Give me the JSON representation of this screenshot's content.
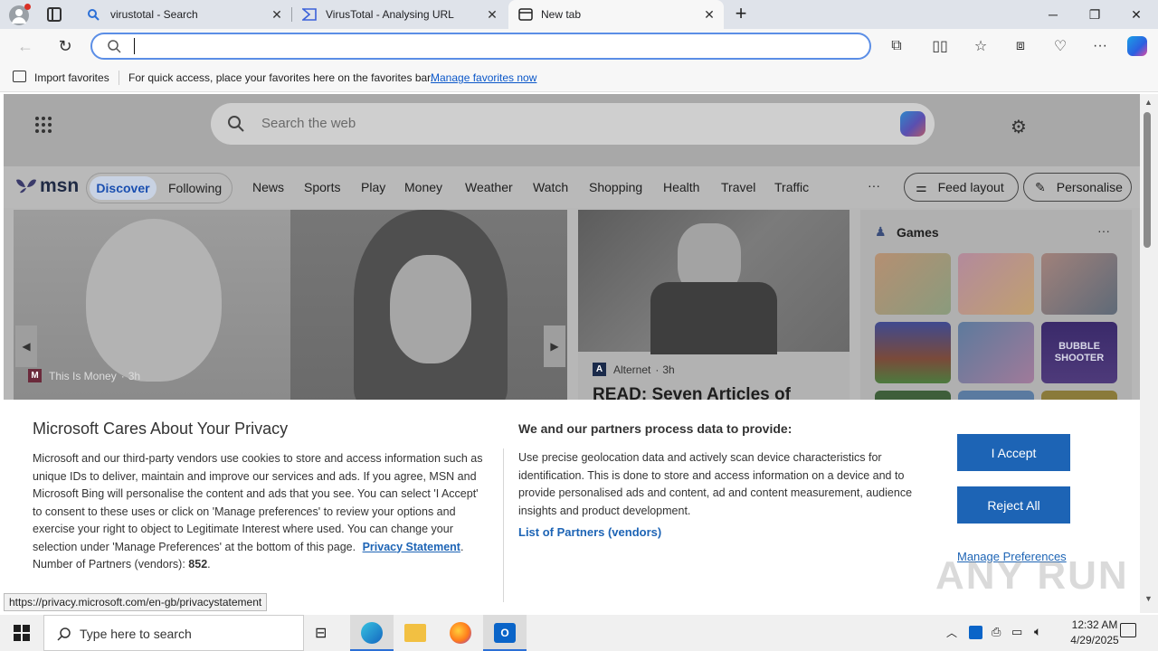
{
  "browser": {
    "tabs": [
      {
        "title": "virustotal - Search"
      },
      {
        "title": "VirusTotal - Analysing URL"
      },
      {
        "title": "New tab"
      }
    ],
    "address_value": "",
    "favorites_bar": {
      "import_label": "Import favorites",
      "message": "For quick access, place your favorites here on the favorites bar.",
      "manage_link": "Manage favorites now"
    }
  },
  "msn": {
    "search_placeholder": "Search the web",
    "logo_text": "msn",
    "tabs": [
      "Discover",
      "Following"
    ],
    "nav": [
      "News",
      "Sports",
      "Play",
      "Money",
      "Weather",
      "Watch",
      "Shopping",
      "Health",
      "Travel",
      "Traffic"
    ],
    "more": "···",
    "feed_layout": "Feed layout",
    "personalise": "Personalise",
    "card1": {
      "source": "This Is Money",
      "time": "3h"
    },
    "card2": {
      "source": "Alternet",
      "time": "3h",
      "headline": "READ: Seven Articles of"
    },
    "games": {
      "title": "Games",
      "more": "···",
      "tile_text": "BUBBLE SHOOTER"
    }
  },
  "privacy": {
    "title": "Microsoft Cares About Your Privacy",
    "body": "Microsoft and our third-party vendors use cookies to store and access information such as unique IDs to deliver, maintain and improve our services and ads. If you agree, MSN and Microsoft Bing will personalise the content and ads that you see. You can select 'I Accept' to consent to these uses or click on 'Manage preferences' to review your options and exercise your right to object to Legitimate Interest where used.  You can change your selection under 'Manage Preferences' at the bottom of this page.",
    "privacy_link": "Privacy Statement",
    "partners_label": "Number of Partners (vendors):",
    "partners_count": "852",
    "right_title": "We and our partners process data to provide:",
    "right_body": "Use precise geolocation data and actively scan device characteristics for identification. This is done to store and access information on a device and to provide personalised ads and content, ad and content measurement, audience insights and product development.",
    "partners_link": "List of Partners (vendors)",
    "accept": "I Accept",
    "reject": "Reject All",
    "manage": "Manage Preferences"
  },
  "status_url": "https://privacy.microsoft.com/en-gb/privacystatement",
  "watermark": "ANY RUN",
  "taskbar": {
    "search_placeholder": "Type here to search",
    "time": "12:32 AM",
    "date": "4/29/2025"
  }
}
